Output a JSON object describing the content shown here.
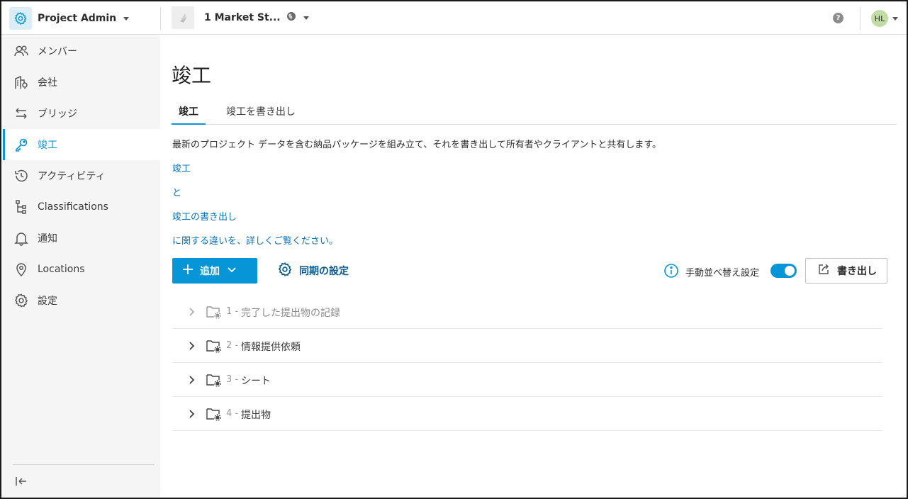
{
  "header": {
    "app_name": "Project Admin",
    "project_name": "1 Market St...",
    "help_label": "?",
    "user_initials": "HL"
  },
  "sidebar": {
    "items": [
      {
        "label": "メンバー",
        "icon": "members-icon"
      },
      {
        "label": "会社",
        "icon": "company-icon"
      },
      {
        "label": "ブリッジ",
        "icon": "bridge-icon"
      },
      {
        "label": "竣工",
        "icon": "key-icon",
        "active": true
      },
      {
        "label": "アクティビティ",
        "icon": "activity-icon"
      },
      {
        "label": "Classifications",
        "icon": "classifications-icon"
      },
      {
        "label": "通知",
        "icon": "bell-icon"
      },
      {
        "label": "Locations",
        "icon": "location-icon"
      },
      {
        "label": "設定",
        "icon": "gear-icon"
      }
    ]
  },
  "main": {
    "title": "竣工",
    "tabs": [
      {
        "label": "竣工",
        "active": true
      },
      {
        "label": "竣工を書き出し"
      }
    ],
    "description": "最新のプロジェクト データを含む納品パッケージを組み立て、それを書き出して所有者やクライアントと共有します。",
    "links": [
      "竣工",
      "と",
      "竣工の書き出し",
      "に関する違いを、詳しくご覧ください。"
    ],
    "add_button": "追加",
    "sync_button": "同期の設定",
    "manual_sort_label": "手動並べ替え設定",
    "manual_sort_on": true,
    "export_button": "書き出し",
    "rows": [
      {
        "number": "1 -",
        "name": "完了した提出物の記録",
        "dim": true
      },
      {
        "number": "2 -",
        "name": "情報提供依頼"
      },
      {
        "number": "3 -",
        "name": "シート"
      },
      {
        "number": "4 -",
        "name": "提出物"
      }
    ]
  },
  "colors": {
    "accent": "#0696d7",
    "link": "#0a72b8",
    "sidebar_bg": "#f5f5f5"
  }
}
